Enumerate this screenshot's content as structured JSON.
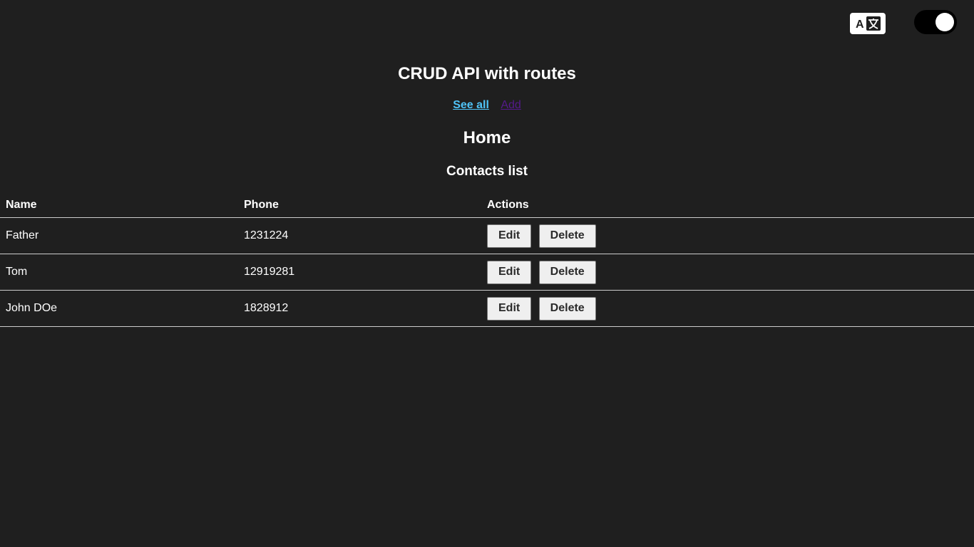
{
  "header": {
    "translate_icon": "translate-icon",
    "theme_toggle_state": "on"
  },
  "app": {
    "title": "CRUD API with routes"
  },
  "nav": {
    "see_all": "See all",
    "add": "Add"
  },
  "page": {
    "heading": "Home",
    "section_title": "Contacts list"
  },
  "table": {
    "columns": [
      "Name",
      "Phone",
      "Actions"
    ],
    "rows": [
      {
        "name": "Father",
        "phone": "1231224",
        "edit": "Edit",
        "delete": "Delete"
      },
      {
        "name": "Tom",
        "phone": "12919281",
        "edit": "Edit",
        "delete": "Delete"
      },
      {
        "name": "John DOe",
        "phone": "1828912",
        "edit": "Edit",
        "delete": "Delete"
      }
    ]
  },
  "colors": {
    "background": "#1f1f1f",
    "active_link": "#4fc3f7",
    "visited_link": "#551a8b"
  }
}
